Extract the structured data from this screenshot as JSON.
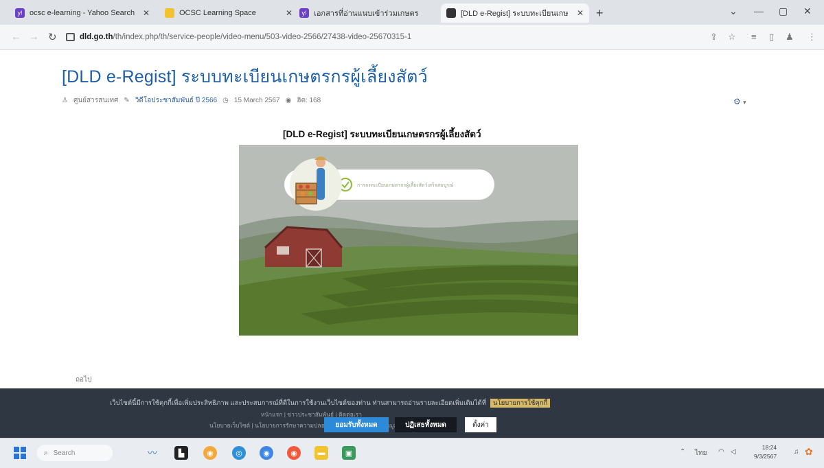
{
  "browser": {
    "tabs": [
      {
        "title": "ocsc e-learning - Yahoo Search",
        "favicon_color": "#6b3fc8"
      },
      {
        "title": "OCSC Learning Space",
        "favicon_color": "#f2c230"
      },
      {
        "title": "เอกสารที่อ่านแนบเข้าร่วมเกษตร",
        "favicon_color": "#6b3fc8"
      },
      {
        "title": "[DLD e-Regist] ระบบทะเบียนเกษ",
        "favicon_color": "#333333"
      }
    ],
    "active_tab_index": 3,
    "new_tab": "+",
    "address": {
      "host": "dld.go.th",
      "path": "/th/index.php/th/service-people/video-menu/503-video-2566/27438-video-25670315-1"
    }
  },
  "article": {
    "title": "[DLD e-Regist] ระบบทะเบียนเกษตรกรผู้เลี้ยงสัตว์",
    "meta": {
      "author": "ศูนย์สารสนเทศ",
      "category": "วิดีโอประชาสัมพันธ์ ปี 2566",
      "date": "15 March 2567",
      "views": "ฮิต: 168"
    },
    "video_heading": "[DLD e-Regist] ระบบทะเบียนเกษตรกรผู้เลี้ยงสัตว์",
    "video_card_text": "การลงทะเบียนเกษตรกรผู้เลี้ยงสัตว์เสร็จสมบูรณ์",
    "read_more": "ถอไป"
  },
  "cookie_banner": {
    "line1": "เว็บไซต์นี้มีการใช้คุกกี้เพื่อเพิ่มประสิทธิภาพ และประสบการณ์ที่ดีในการใช้งานเว็บไซต์ของท่าน ท่านสามารถอ่านรายละเอียดเพิ่มเติมได้ที่",
    "policy_link": "นโยบายการใช้คุกกี้",
    "line2": "หน้าแรก | ข่าวประชาสัมพันธ์ | ติดต่อเรา",
    "line3": "นโยบายเว็บไซต์ | นโยบายการรักษาความปลอดภัย | นโยบายคุ้มครองข้อมูลส่วนบุคคล",
    "accept_all": "ยอมรับทั้งหมด",
    "reject_all": "ปฏิเสธทั้งหมด",
    "settings": "ตั้งค่า"
  },
  "taskbar": {
    "search_placeholder": "Search",
    "tray_lang": "ไทย",
    "time": "18:24",
    "date": "9/3/2567"
  }
}
